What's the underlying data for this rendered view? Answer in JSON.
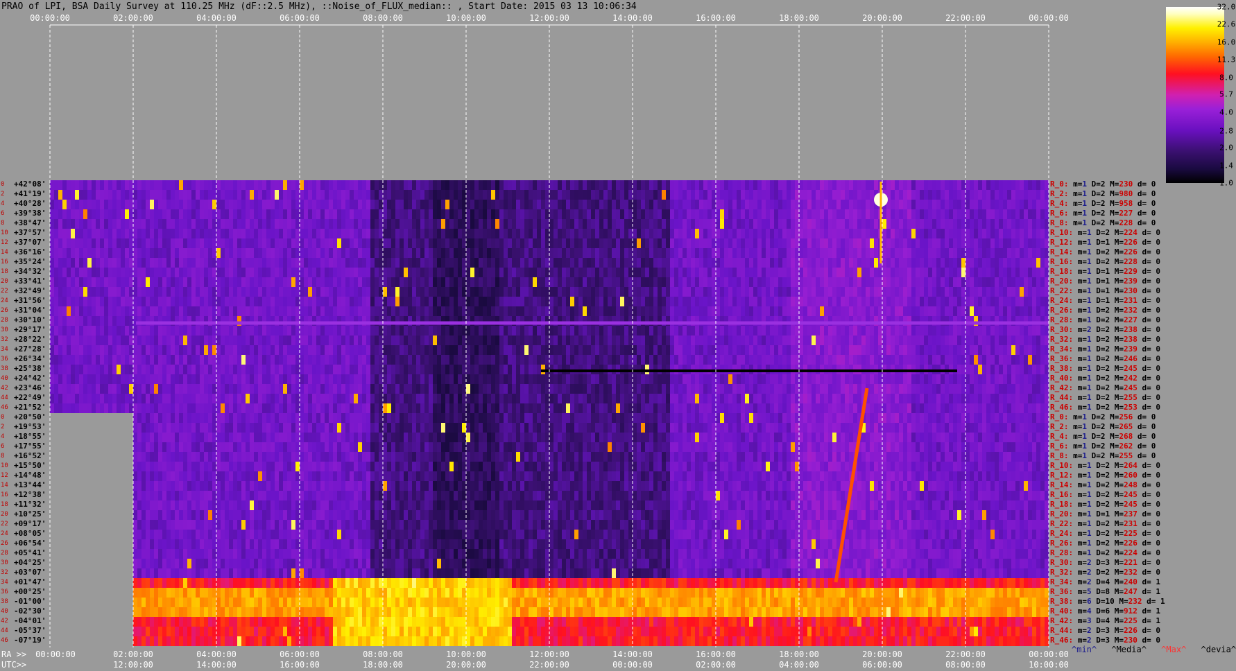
{
  "title": "PRAO of LPI, BSA Daily Survey at 110.25 MHz (dF::2.5 MHz), ::Noise_of_FLUX_median:: , Start Date: 2015 03 13 10:06:34",
  "top_ticks": [
    "00:00:00",
    "02:00:00",
    "04:00:00",
    "06:00:00",
    "08:00:00",
    "10:00:00",
    "12:00:00",
    "14:00:00",
    "16:00:00",
    "18:00:00",
    "20:00:00",
    "22:00:00",
    "00:00:00"
  ],
  "ra_label": "RA >>",
  "ra_ticks": [
    "00:00:00",
    "02:00:00",
    "04:00:00",
    "06:00:00",
    "08:00:00",
    "10:00:00",
    "12:00:00",
    "14:00:00",
    "16:00:00",
    "18:00:00",
    "20:00:00",
    "22:00:00",
    "00:00:00"
  ],
  "utc_label": "UTC>>",
  "utc_ticks": [
    "12:00:00",
    "14:00:00",
    "16:00:00",
    "18:00:00",
    "20:00:00",
    "22:00:00",
    "00:00:00",
    "02:00:00",
    "04:00:00",
    "06:00:00",
    "08:00:00",
    "10:00:00"
  ],
  "colorbar": {
    "ticks": [
      "32.0",
      "22.6",
      "16.0",
      "11.3",
      "8.0",
      "5.7",
      "4.0",
      "2.8",
      "2.0",
      "1.4",
      "1.0"
    ]
  },
  "stat_legend": {
    "min": "^min^",
    "median": "^Media^",
    "max": "^Max^",
    "devia": "^devia^"
  },
  "chart_data": {
    "type": "heatmap",
    "title": "PRAO of LPI, BSA Daily Survey at 110.25 MHz (dF::2.5 MHz), ::Noise_of_FLUX_median:: , Start Date: 2015 03 13 10:06:34",
    "x_ticks_ra": [
      "00:00:00",
      "02:00:00",
      "04:00:00",
      "06:00:00",
      "08:00:00",
      "10:00:00",
      "12:00:00",
      "14:00:00",
      "16:00:00",
      "18:00:00",
      "20:00:00",
      "22:00:00",
      "00:00:00"
    ],
    "x_ticks_utc": [
      "12:00:00",
      "14:00:00",
      "16:00:00",
      "18:00:00",
      "20:00:00",
      "22:00:00",
      "00:00:00",
      "02:00:00",
      "04:00:00",
      "06:00:00",
      "08:00:00",
      "10:00:00"
    ],
    "declinations": [
      "+42°08'",
      "+41°19'",
      "+40°28'",
      "+39°38'",
      "+38°47'",
      "+37°57'",
      "+37°07'",
      "+36°16'",
      "+35°24'",
      "+34°32'",
      "+33°41'",
      "+32°49'",
      "+31°56'",
      "+31°04'",
      "+30°10'",
      "+29°17'",
      "+28°22'",
      "+27°28'",
      "+26°34'",
      "+25°38'",
      "+24°42'",
      "+23°46'",
      "+22°49'",
      "+21°52'",
      "+20°50'",
      "+19°53'",
      "+18°55'",
      "+17°55'",
      "+16°52'",
      "+15°50'",
      "+14°48'",
      "+13°44'",
      "+12°38'",
      "+11°32'",
      "+10°25'",
      "+09°17'",
      "+08°05'",
      "+06°54'",
      "+05°41'",
      "+04°25'",
      "+03°07'",
      "+01°47'",
      "+00°25'",
      "-01°00'",
      "-02°30'",
      "-04°01'",
      "-05°37'",
      "-07°19'"
    ],
    "row_index": [
      "0",
      "2",
      "4",
      "6",
      "8",
      "10",
      "12",
      "14",
      "16",
      "18",
      "20",
      "22",
      "24",
      "26",
      "28",
      "30",
      "32",
      "34",
      "36",
      "38",
      "40",
      "42",
      "44",
      "46",
      "0",
      "2",
      "4",
      "6",
      "8",
      "10",
      "12",
      "14",
      "16",
      "18",
      "20",
      "22",
      "24",
      "26",
      "28",
      "30",
      "32",
      "34",
      "36",
      "38",
      "40",
      "42",
      "44",
      "46"
    ],
    "colorbar_range": [
      1.0,
      32.0
    ],
    "colorbar_scale": "log",
    "stats": [
      {
        "r": "R_0:",
        "m": "1",
        "D": "2",
        "M": "230",
        "d": "0"
      },
      {
        "r": "R_2:",
        "m": "1",
        "D": "2",
        "M": "980",
        "d": "0"
      },
      {
        "r": "R_4:",
        "m": "1",
        "D": "2",
        "M": "958",
        "d": "0"
      },
      {
        "r": "R_6:",
        "m": "1",
        "D": "2",
        "M": "227",
        "d": "0"
      },
      {
        "r": "R_8:",
        "m": "1",
        "D": "2",
        "M": "228",
        "d": "0"
      },
      {
        "r": "R_10:",
        "m": "1",
        "D": "2",
        "M": "224",
        "d": "0"
      },
      {
        "r": "R_12:",
        "m": "1",
        "D": "1",
        "M": "226",
        "d": "0"
      },
      {
        "r": "R_14:",
        "m": "1",
        "D": "2",
        "M": "226",
        "d": "0"
      },
      {
        "r": "R_16:",
        "m": "1",
        "D": "2",
        "M": "228",
        "d": "0"
      },
      {
        "r": "R_18:",
        "m": "1",
        "D": "1",
        "M": "229",
        "d": "0"
      },
      {
        "r": "R_20:",
        "m": "1",
        "D": "1",
        "M": "239",
        "d": "0"
      },
      {
        "r": "R_22:",
        "m": "1",
        "D": "1",
        "M": "230",
        "d": "0"
      },
      {
        "r": "R_24:",
        "m": "1",
        "D": "1",
        "M": "231",
        "d": "0"
      },
      {
        "r": "R_26:",
        "m": "1",
        "D": "2",
        "M": "232",
        "d": "0"
      },
      {
        "r": "R_28:",
        "m": "1",
        "D": "2",
        "M": "227",
        "d": "0"
      },
      {
        "r": "R_30:",
        "m": "2",
        "D": "2",
        "M": "238",
        "d": "0"
      },
      {
        "r": "R_32:",
        "m": "1",
        "D": "2",
        "M": "238",
        "d": "0"
      },
      {
        "r": "R_34:",
        "m": "1",
        "D": "2",
        "M": "239",
        "d": "0"
      },
      {
        "r": "R_36:",
        "m": "1",
        "D": "2",
        "M": "246",
        "d": "0"
      },
      {
        "r": "R_38:",
        "m": "1",
        "D": "2",
        "M": "245",
        "d": "0"
      },
      {
        "r": "R_40:",
        "m": "1",
        "D": "2",
        "M": "242",
        "d": "0"
      },
      {
        "r": "R_42:",
        "m": "1",
        "D": "2",
        "M": "245",
        "d": "0"
      },
      {
        "r": "R_44:",
        "m": "1",
        "D": "2",
        "M": "255",
        "d": "0"
      },
      {
        "r": "R_46:",
        "m": "1",
        "D": "2",
        "M": "253",
        "d": "0"
      },
      {
        "r": "R_0:",
        "m": "1",
        "D": "2",
        "M": "256",
        "d": "0"
      },
      {
        "r": "R_2:",
        "m": "1",
        "D": "2",
        "M": "265",
        "d": "0"
      },
      {
        "r": "R_4:",
        "m": "1",
        "D": "2",
        "M": "268",
        "d": "0"
      },
      {
        "r": "R_6:",
        "m": "1",
        "D": "2",
        "M": "262",
        "d": "0"
      },
      {
        "r": "R_8:",
        "m": "1",
        "D": "2",
        "M": "255",
        "d": "0"
      },
      {
        "r": "R_10:",
        "m": "1",
        "D": "2",
        "M": "264",
        "d": "0"
      },
      {
        "r": "R_12:",
        "m": "1",
        "D": "2",
        "M": "260",
        "d": "0"
      },
      {
        "r": "R_14:",
        "m": "1",
        "D": "2",
        "M": "248",
        "d": "0"
      },
      {
        "r": "R_16:",
        "m": "1",
        "D": "2",
        "M": "245",
        "d": "0"
      },
      {
        "r": "R_18:",
        "m": "1",
        "D": "2",
        "M": "245",
        "d": "0"
      },
      {
        "r": "R_20:",
        "m": "1",
        "D": "1",
        "M": "237",
        "d": "0"
      },
      {
        "r": "R_22:",
        "m": "1",
        "D": "2",
        "M": "231",
        "d": "0"
      },
      {
        "r": "R_24:",
        "m": "1",
        "D": "2",
        "M": "225",
        "d": "0"
      },
      {
        "r": "R_26:",
        "m": "1",
        "D": "2",
        "M": "226",
        "d": "0"
      },
      {
        "r": "R_28:",
        "m": "1",
        "D": "2",
        "M": "224",
        "d": "0"
      },
      {
        "r": "R_30:",
        "m": "2",
        "D": "3",
        "M": "221",
        "d": "0"
      },
      {
        "r": "R_32:",
        "m": "2",
        "D": "2",
        "M": "232",
        "d": "0"
      },
      {
        "r": "R_34:",
        "m": "2",
        "D": "4",
        "M": "240",
        "d": "1"
      },
      {
        "r": "R_36:",
        "m": "5",
        "D": "8",
        "M": "247",
        "d": "1"
      },
      {
        "r": "R_38:",
        "m": "6",
        "D": "10",
        "M": "232",
        "d": "1"
      },
      {
        "r": "R_40:",
        "m": "4",
        "D": "6",
        "M": "912",
        "d": "1"
      },
      {
        "r": "R_42:",
        "m": "3",
        "D": "4",
        "M": "225",
        "d": "1"
      },
      {
        "r": "R_44:",
        "m": "2",
        "D": "3",
        "M": "226",
        "d": "0"
      },
      {
        "r": "R_46:",
        "m": "2",
        "D": "3",
        "M": "230",
        "d": "0"
      }
    ]
  }
}
